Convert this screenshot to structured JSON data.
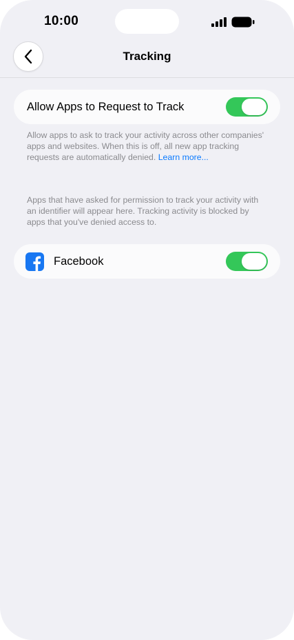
{
  "status_bar": {
    "time": "10:00",
    "icons": [
      "cellular-signal-icon",
      "battery-icon"
    ]
  },
  "nav": {
    "back_icon": "chevron-left-icon",
    "title": "Tracking"
  },
  "allow_tracking": {
    "label": "Allow Apps to Request to Track",
    "enabled": true,
    "toggle_color": "#34c759"
  },
  "footnote_allow": {
    "text": "Allow apps to ask to track your activity across other companies' apps and websites. When this is off, all new app tracking requests are automatically denied.",
    "link": "Learn more..."
  },
  "footnote_apps": {
    "text": "Apps that have asked for permission to track your activity with an identifier will appear here. Tracking activity is blocked by apps that you've denied access to."
  },
  "apps": [
    {
      "name": "Facebook",
      "icon": "facebook-icon",
      "icon_color": "#1877f2",
      "enabled": true
    }
  ],
  "colors": {
    "background": "#f0f0f5",
    "card": "#fbfbfc",
    "link": "#0a7aff",
    "secondary_text": "#8a8a8e"
  }
}
